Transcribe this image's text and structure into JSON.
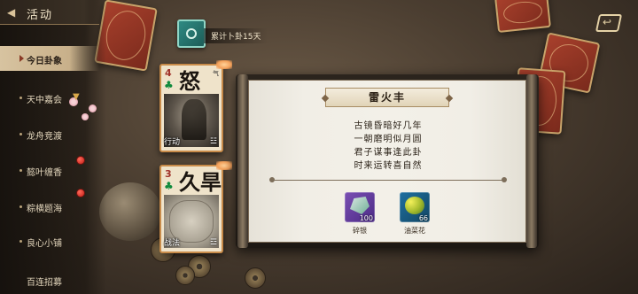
{
  "header": {
    "title": "活动"
  },
  "sidebar": {
    "items": [
      {
        "label": "今日卦象",
        "active": true,
        "badge": false
      },
      {
        "label": "天中嘉会",
        "active": false,
        "badge": false,
        "expandable": true
      },
      {
        "label": "龙舟竞渡",
        "active": false,
        "badge": false
      },
      {
        "label": "懿叶缠香",
        "active": false,
        "badge": true
      },
      {
        "label": "粽横题海",
        "active": false,
        "badge": true
      },
      {
        "label": "良心小铺",
        "active": false,
        "badge": false
      },
      {
        "label": "百连招募",
        "active": false,
        "badge": false
      }
    ]
  },
  "counter": {
    "text": "累计卜卦15天"
  },
  "cards": [
    {
      "number": "4",
      "suit": "♣",
      "character": "怒",
      "tiny": "气",
      "category": "行动",
      "trigram": "☳"
    },
    {
      "number": "3",
      "suit": "♣",
      "character": "久旱",
      "tiny": "",
      "category": "战法",
      "trigram": "☲"
    }
  ],
  "panel": {
    "title": "雷火丰",
    "poem": [
      "古镜昏暗好几年",
      "一朝磨明似月圆",
      "君子谋事逢此卦",
      "时来运转喜自然"
    ],
    "rewards": [
      {
        "name": "碎银",
        "quantity": "100",
        "icon": "silver-ingot-icon"
      },
      {
        "name": "油菜花",
        "quantity": "66",
        "icon": "rapeseed-flower-icon"
      }
    ]
  },
  "colors": {
    "badge_red": "#c41d16",
    "card_border": "#c98c4a",
    "suit_green": "#0f8a3c"
  }
}
